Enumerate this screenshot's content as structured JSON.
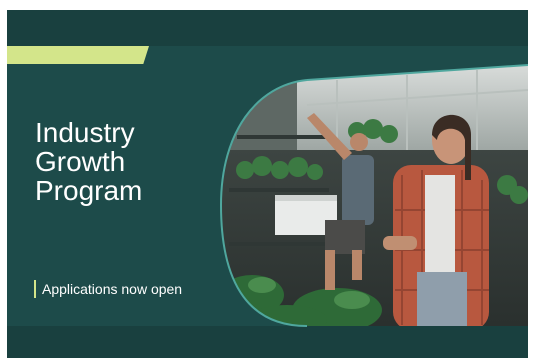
{
  "banner": {
    "title_lines": [
      "Industry",
      "Growth",
      "Program"
    ],
    "subtitle": "Applications now open"
  },
  "colors": {
    "dark_band": "#19403f",
    "panel": "#1d4b4a",
    "accent": "#d3e58a"
  },
  "photo": {
    "icon": "nursery-workers-photo"
  }
}
